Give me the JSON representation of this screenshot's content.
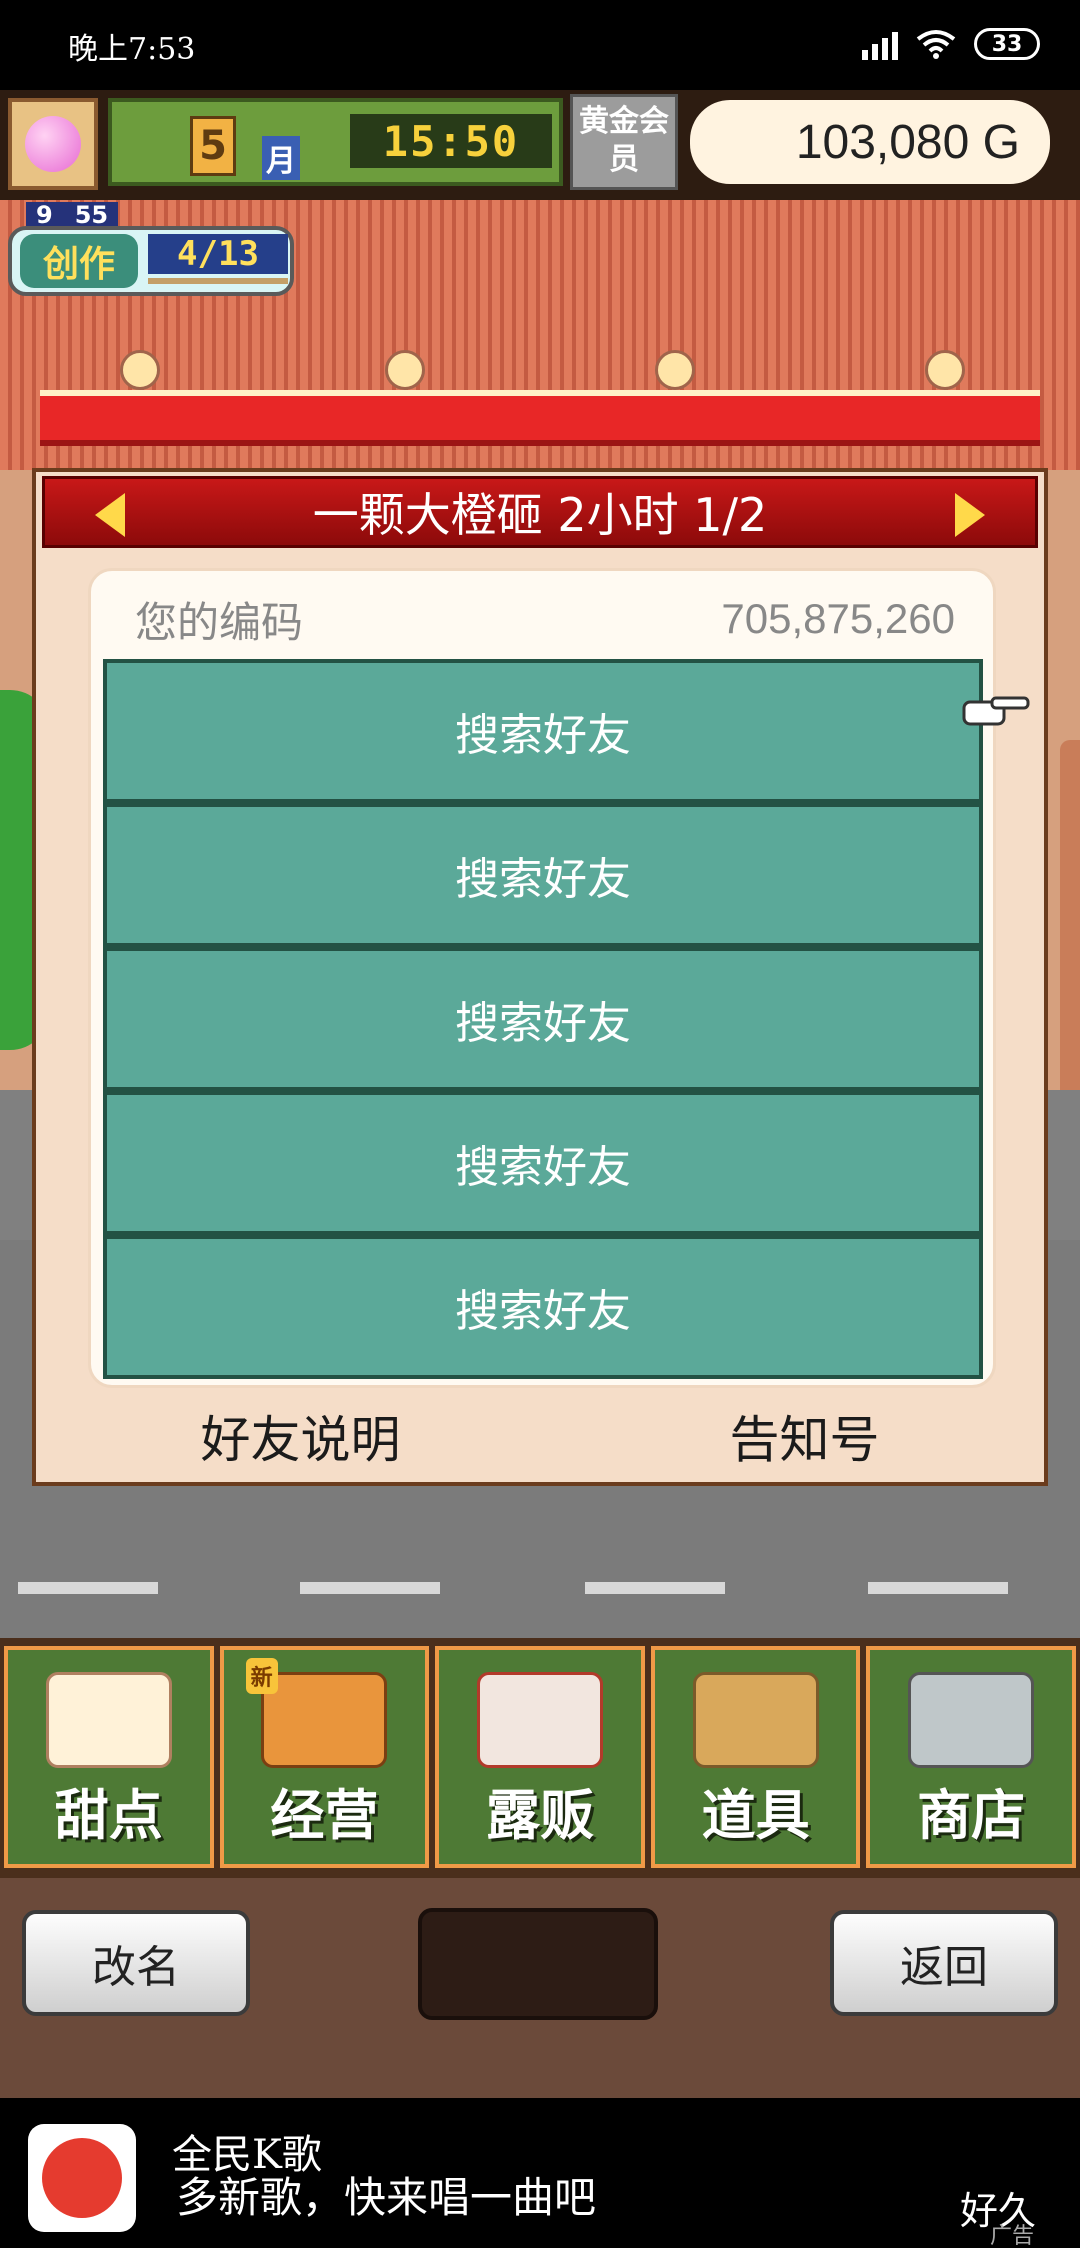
{
  "status_bar": {
    "time": "晚上7:53",
    "battery": "33"
  },
  "hud": {
    "month_number": "5",
    "month_label": "月",
    "clock": "15:50",
    "gold_member": "黄金会员",
    "money": "103,080 G"
  },
  "creation_badge": {
    "level": "9",
    "minutes": "55",
    "label": "创作",
    "count": "4/13"
  },
  "panel": {
    "title": "一颗大橙砸  2小时 1/2",
    "code_label": "您的编码",
    "code_value": "705,875,260",
    "buttons": [
      {
        "label": "搜索好友"
      },
      {
        "label": "搜索好友"
      },
      {
        "label": "搜索好友"
      },
      {
        "label": "搜索好友"
      },
      {
        "label": "搜索好友"
      }
    ],
    "footer_left": "好友说明",
    "footer_right": "告知号"
  },
  "menu": {
    "items": [
      {
        "label": "甜点",
        "icon": "cake-icon"
      },
      {
        "label": "经营",
        "icon": "shop-icon",
        "tag": "新"
      },
      {
        "label": "露贩",
        "icon": "food-truck-icon"
      },
      {
        "label": "道具",
        "icon": "gear-bag-icon"
      },
      {
        "label": "商店",
        "icon": "cart-icon"
      }
    ]
  },
  "controls": {
    "rename": "改名",
    "back": "返回"
  },
  "ad": {
    "title": "全民K歌",
    "text": "多新歌，快来唱一曲吧",
    "right": "好久",
    "tag": "广告"
  }
}
